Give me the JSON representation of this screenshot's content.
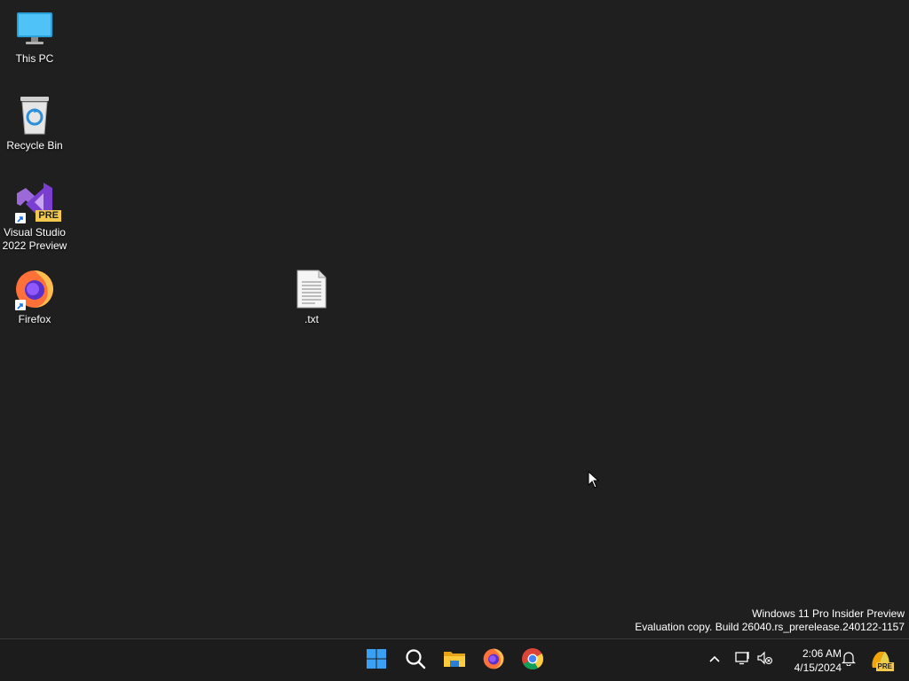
{
  "desktop": {
    "icons": [
      {
        "label": "This PC",
        "icon": "monitor-icon"
      },
      {
        "label": "Recycle Bin",
        "icon": "recycle-bin-icon"
      },
      {
        "label": "Visual Studio 2022 Preview",
        "icon": "visual-studio-icon",
        "badge": "PRE"
      },
      {
        "label": "Firefox",
        "icon": "firefox-icon"
      },
      {
        "label": ".txt",
        "icon": "text-file-icon"
      }
    ]
  },
  "watermark": {
    "line1": "Windows 11 Pro Insider Preview",
    "line2": "Evaluation copy. Build 26040.rs_prerelease.240122-1157"
  },
  "taskbar": {
    "apps": [
      {
        "name": "Start",
        "icon": "windows-start-icon"
      },
      {
        "name": "Search",
        "icon": "search-icon"
      },
      {
        "name": "File Explorer",
        "icon": "folder-icon"
      },
      {
        "name": "Firefox",
        "icon": "firefox-icon"
      },
      {
        "name": "Chrome",
        "icon": "chrome-icon"
      }
    ],
    "tray": {
      "time": "2:06 AM",
      "date": "4/15/2024",
      "copilot_badge": "PRE"
    }
  },
  "colors": {
    "desktop_bg": "#1f1f1f",
    "taskbar_bg": "#1c1c1c",
    "vs_purple": "#7a3fd0",
    "pre_badge": "#f2c94c"
  }
}
